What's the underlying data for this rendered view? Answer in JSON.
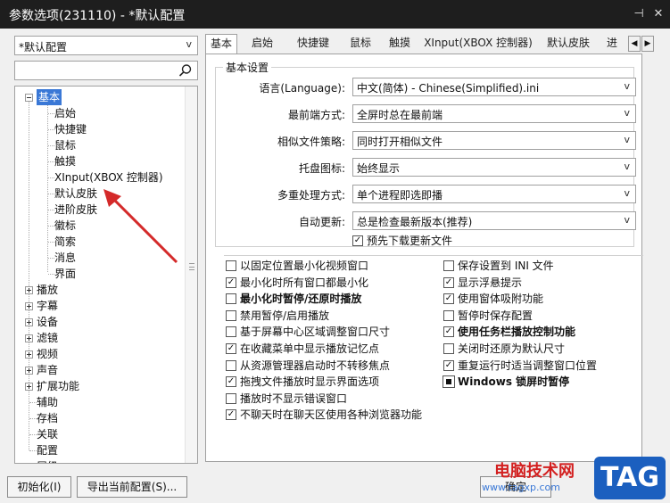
{
  "window": {
    "title": "参数选项(231110) - *默认配置",
    "pin_glyph": "⊣",
    "close_glyph": "✕"
  },
  "left": {
    "profile_value": "*默认配置",
    "search_placeholder": "",
    "tree": [
      {
        "label": "基本",
        "level": 0,
        "expander": "minus",
        "selected": true
      },
      {
        "label": "启始",
        "level": 1
      },
      {
        "label": "快捷键",
        "level": 1
      },
      {
        "label": "鼠标",
        "level": 1
      },
      {
        "label": "触摸",
        "level": 1
      },
      {
        "label": "XInput(XBOX 控制器)",
        "level": 1
      },
      {
        "label": "默认皮肤",
        "level": 1
      },
      {
        "label": "进阶皮肤",
        "level": 1
      },
      {
        "label": "徽标",
        "level": 1
      },
      {
        "label": "简索",
        "level": 1
      },
      {
        "label": "消息",
        "level": 1
      },
      {
        "label": "界面",
        "level": 1
      },
      {
        "label": "播放",
        "level": 0,
        "expander": "plus"
      },
      {
        "label": "字幕",
        "level": 0,
        "expander": "plus"
      },
      {
        "label": "设备",
        "level": 0,
        "expander": "plus"
      },
      {
        "label": "滤镜",
        "level": 0,
        "expander": "plus"
      },
      {
        "label": "视频",
        "level": 0,
        "expander": "plus"
      },
      {
        "label": "声音",
        "level": 0,
        "expander": "plus"
      },
      {
        "label": "扩展功能",
        "level": 0,
        "expander": "plus"
      },
      {
        "label": "辅助",
        "level": 0
      },
      {
        "label": "存档",
        "level": 0
      },
      {
        "label": "关联",
        "level": 0
      },
      {
        "label": "配置",
        "level": 0
      },
      {
        "label": "层级",
        "level": 0
      }
    ]
  },
  "buttons": {
    "init": "初始化(I)",
    "export": "导出当前配置(S)...",
    "partial": "确定"
  },
  "tabs": {
    "items": [
      "基本",
      "启始",
      "快捷键",
      "鼠标",
      "触摸",
      "XInput(XBOX 控制器)",
      "默认皮肤",
      "进"
    ],
    "active_index": 0,
    "scroll_left": "◀",
    "scroll_right": "▶"
  },
  "basic": {
    "group_title": "基本设置",
    "settings": [
      {
        "label": "语言(Language):",
        "value": "中文(简体) - Chinese(Simplified).ini"
      },
      {
        "label": "最前端方式:",
        "value": "全屏时总在最前端"
      },
      {
        "label": "相似文件策略:",
        "value": "同时打开相似文件"
      },
      {
        "label": "托盘图标:",
        "value": "始终显示"
      },
      {
        "label": "多重处理方式:",
        "value": "单个进程即选即播"
      },
      {
        "label": "自动更新:",
        "value": "总是检查最新版本(推荐)"
      }
    ],
    "predownload": {
      "label": "预先下载更新文件",
      "checked": true
    }
  },
  "options_left": [
    {
      "label": "以固定位置最小化视频窗口",
      "checked": false,
      "bold": false
    },
    {
      "label": "最小化时所有窗口都最小化",
      "checked": true,
      "bold": false
    },
    {
      "label": "最小化时暂停/还原时播放",
      "checked": false,
      "bold": true
    },
    {
      "label": "禁用暂停/启用播放",
      "checked": false,
      "bold": false
    },
    {
      "label": "基于屏幕中心区域调整窗口尺寸",
      "checked": false,
      "bold": false
    },
    {
      "label": "在收藏菜单中显示播放记忆点",
      "checked": true,
      "bold": false
    },
    {
      "label": "从资源管理器启动时不转移焦点",
      "checked": false,
      "bold": false
    },
    {
      "label": "拖拽文件播放时显示界面选项",
      "checked": true,
      "bold": false
    },
    {
      "label": "播放时不显示错误窗口",
      "checked": false,
      "bold": false
    },
    {
      "label": "不聊天时在聊天区使用各种浏览器功能",
      "checked": true,
      "bold": false
    }
  ],
  "options_right": [
    {
      "label": "保存设置到 INI 文件",
      "checked": false,
      "bold": false,
      "filled": false
    },
    {
      "label": "显示浮悬提示",
      "checked": true,
      "bold": false,
      "filled": false
    },
    {
      "label": "使用窗体吸附功能",
      "checked": true,
      "bold": false,
      "filled": false
    },
    {
      "label": "暂停时保存配置",
      "checked": false,
      "bold": false,
      "filled": false
    },
    {
      "label": "使用任务栏播放控制功能",
      "checked": true,
      "bold": true,
      "filled": false
    },
    {
      "label": "关闭时还原为默认尺寸",
      "checked": false,
      "bold": false,
      "filled": false
    },
    {
      "label": "重复运行时适当调整窗口位置",
      "checked": true,
      "bold": false,
      "filled": false
    },
    {
      "label": "Windows 锁屏时暂停",
      "checked": false,
      "bold": true,
      "filled": true
    }
  ],
  "watermark": {
    "text": "电脑技术网",
    "url": "www.tagxp.com",
    "tag": "TAG"
  },
  "colors": {
    "titlebar": "#1e1e1e",
    "selection": "#3a78d6",
    "annotation_arrow": "#d42a2a"
  }
}
